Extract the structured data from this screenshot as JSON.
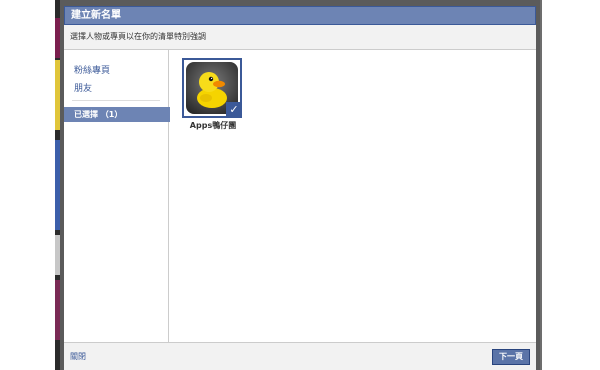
{
  "dialog": {
    "title": "建立新名單",
    "subtitle": "選擇人物或專頁以在你的清單特別強調"
  },
  "sidebar": {
    "items": [
      {
        "label": "粉絲專頁"
      },
      {
        "label": "朋友"
      }
    ],
    "selected_label": "已選擇 （1）"
  },
  "content": {
    "cards": [
      {
        "label": "Apps鴨仔團",
        "icon": "duck-icon",
        "selected": true
      }
    ]
  },
  "footer": {
    "close_label": "關閉",
    "next_label": "下一頁"
  },
  "colors": {
    "title_bar": "#6d84b4",
    "accent": "#3b5998",
    "button": "#5b74a8"
  }
}
